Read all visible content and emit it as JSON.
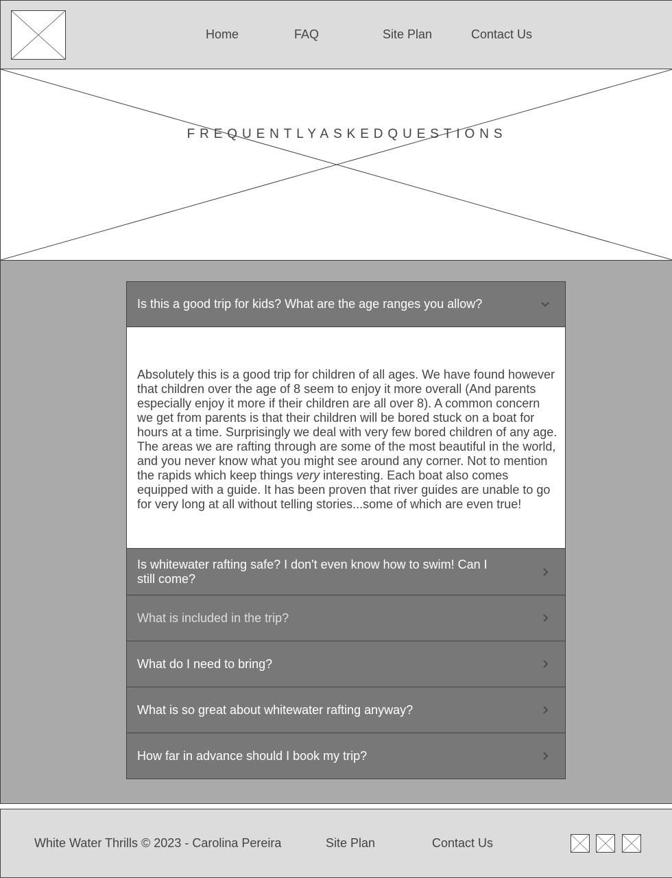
{
  "header": {
    "logo": "image-placeholder",
    "nav": [
      {
        "label": "Home"
      },
      {
        "label": "FAQ"
      },
      {
        "label": "Site Plan"
      },
      {
        "label": "Contact Us"
      }
    ]
  },
  "hero": {
    "image": "image-placeholder",
    "title": "FREQUENTLYASKEDQUESTIONS"
  },
  "faq": {
    "items": [
      {
        "question": "Is this a good trip for kids? What are the age ranges you allow?",
        "state": "expanded",
        "icon": "chevron-down-icon",
        "answer_before_em": "Absolutely this is a good trip for children of all ages. We have found however that children over the age of 8 seem to enjoy it more overall (And parents especially enjoy it more if their children are all over 8). A common concern we get from parents is that their children will be bored stuck on a boat for hours at a time. Surprisingly we deal with very few bored children of any age. The areas we are rafting through are some of the most beautiful in the world, and you never know what you might see around any corner. Not to mention the rapids which keep things ",
        "answer_em": "very",
        "answer_after_em": " interesting. Each boat also comes equipped with a guide. It has been proven that river guides are unable to go for very long at all without telling stories...some of which are even true!"
      },
      {
        "question": "Is whitewater rafting safe? I don't even know how to swim! Can I still come?",
        "state": "collapsed",
        "icon": "chevron-right-icon"
      },
      {
        "question": "What is included in the trip?",
        "state": "collapsed",
        "icon": "chevron-right-icon"
      },
      {
        "question": "What do I need to bring?",
        "state": "collapsed",
        "icon": "chevron-right-icon"
      },
      {
        "question": "What is so great about whitewater rafting anyway?",
        "state": "collapsed",
        "icon": "chevron-right-icon"
      },
      {
        "question": "How far in advance should I book my trip?",
        "state": "collapsed",
        "icon": "chevron-right-icon"
      }
    ]
  },
  "footer": {
    "copyright": "White Water Thrills © 2023 - Carolina Pereira",
    "links": [
      {
        "label": "Site Plan"
      },
      {
        "label": "Contact Us"
      }
    ],
    "social": [
      "social-icon-placeholder",
      "social-icon-placeholder",
      "social-icon-placeholder"
    ]
  },
  "colors": {
    "header_bg": "#dcdcdc",
    "main_bg": "#aaaaaa",
    "accordion_header_bg": "#787878",
    "border": "#444444",
    "text": "#444444"
  }
}
